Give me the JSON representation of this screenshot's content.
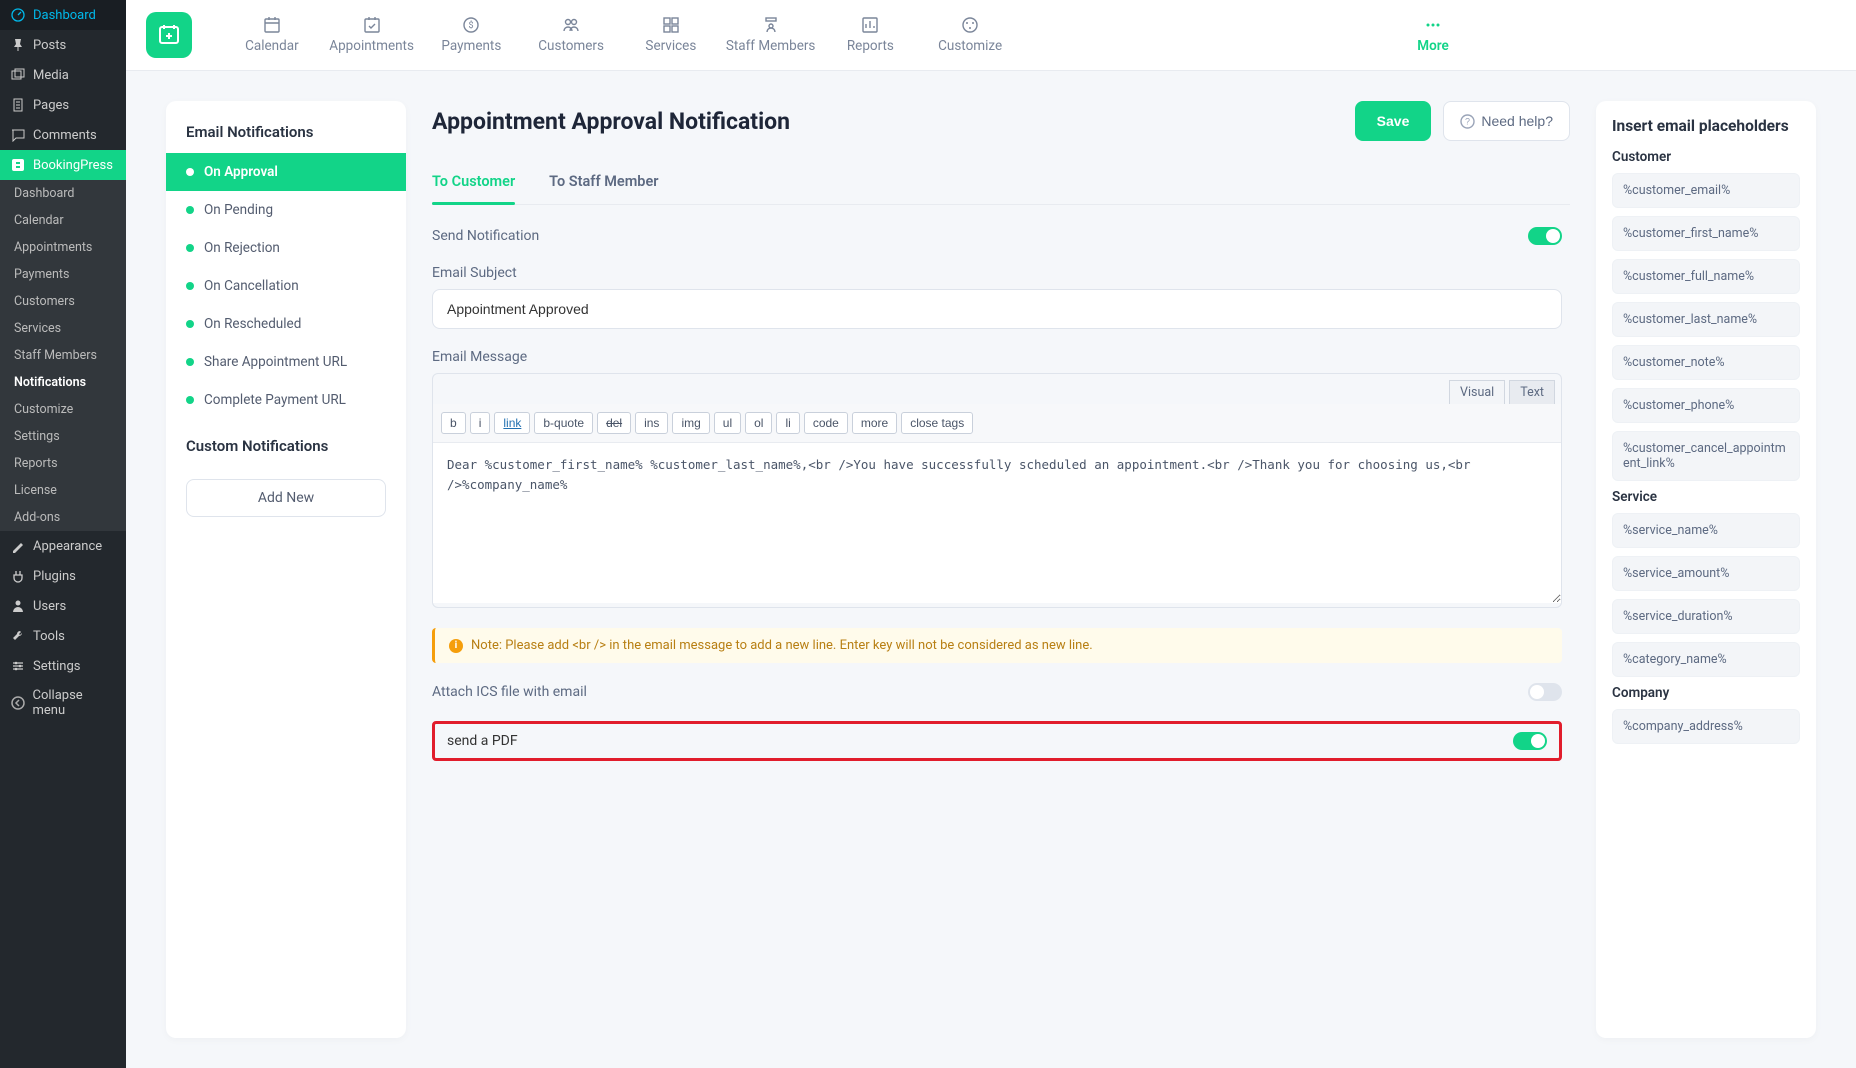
{
  "wp_sidebar": {
    "items_top": [
      {
        "label": "Dashboard",
        "icon": "dashboard"
      },
      {
        "label": "Posts",
        "icon": "pin"
      },
      {
        "label": "Media",
        "icon": "media"
      },
      {
        "label": "Pages",
        "icon": "pages"
      },
      {
        "label": "Comments",
        "icon": "comments"
      }
    ],
    "bp_label": "BookingPress",
    "bp_subitems": [
      "Dashboard",
      "Calendar",
      "Appointments",
      "Payments",
      "Customers",
      "Services",
      "Staff Members",
      "Notifications",
      "Customize",
      "Settings",
      "Reports",
      "License",
      "Add-ons"
    ],
    "bp_active_sub": "Notifications",
    "items_bottom": [
      {
        "label": "Appearance",
        "icon": "appearance"
      },
      {
        "label": "Plugins",
        "icon": "plugins"
      },
      {
        "label": "Users",
        "icon": "users"
      },
      {
        "label": "Tools",
        "icon": "tools"
      },
      {
        "label": "Settings",
        "icon": "settings"
      }
    ],
    "collapse": "Collapse menu"
  },
  "topnav": {
    "items": [
      "Calendar",
      "Appointments",
      "Payments",
      "Customers",
      "Services",
      "Staff Members",
      "Reports",
      "Customize"
    ],
    "more": "More"
  },
  "left_card": {
    "title1": "Email Notifications",
    "events": [
      "On Approval",
      "On Pending",
      "On Rejection",
      "On Cancellation",
      "On Rescheduled",
      "Share Appointment URL",
      "Complete Payment URL"
    ],
    "active_event": "On Approval",
    "title2": "Custom Notifications",
    "add_new": "Add New"
  },
  "main": {
    "title": "Appointment Approval Notification",
    "save": "Save",
    "help": "Need help?",
    "tabs": [
      "To Customer",
      "To Staff Member"
    ],
    "active_tab": "To Customer",
    "send_notification_label": "Send Notification",
    "send_notification_on": true,
    "subject_label": "Email Subject",
    "subject_value": "Appointment Approved",
    "message_label": "Email Message",
    "editor_modes": {
      "visual": "Visual",
      "text": "Text",
      "active": "Text"
    },
    "toolbar": [
      "b",
      "i",
      "link",
      "b-quote",
      "del",
      "ins",
      "img",
      "ul",
      "ol",
      "li",
      "code",
      "more",
      "close tags"
    ],
    "message_value": "Dear %customer_first_name% %customer_last_name%,<br />You have successfully scheduled an appointment.<br />Thank you for choosing us,<br />%company_name%",
    "note": "Note: Please add <br /> in the email message to add a new line. Enter key will not be considered as new line.",
    "attach_ics_label": "Attach ICS file with email",
    "attach_ics_on": false,
    "send_pdf_label": "send a PDF",
    "send_pdf_on": true
  },
  "right_panel": {
    "title": "Insert email placeholders",
    "sections": [
      {
        "name": "Customer",
        "items": [
          "%customer_email%",
          "%customer_first_name%",
          "%customer_full_name%",
          "%customer_last_name%",
          "%customer_note%",
          "%customer_phone%",
          "%customer_cancel_appointment_link%"
        ]
      },
      {
        "name": "Service",
        "items": [
          "%service_name%",
          "%service_amount%",
          "%service_duration%",
          "%category_name%"
        ]
      },
      {
        "name": "Company",
        "items": [
          "%company_address%"
        ]
      }
    ]
  }
}
